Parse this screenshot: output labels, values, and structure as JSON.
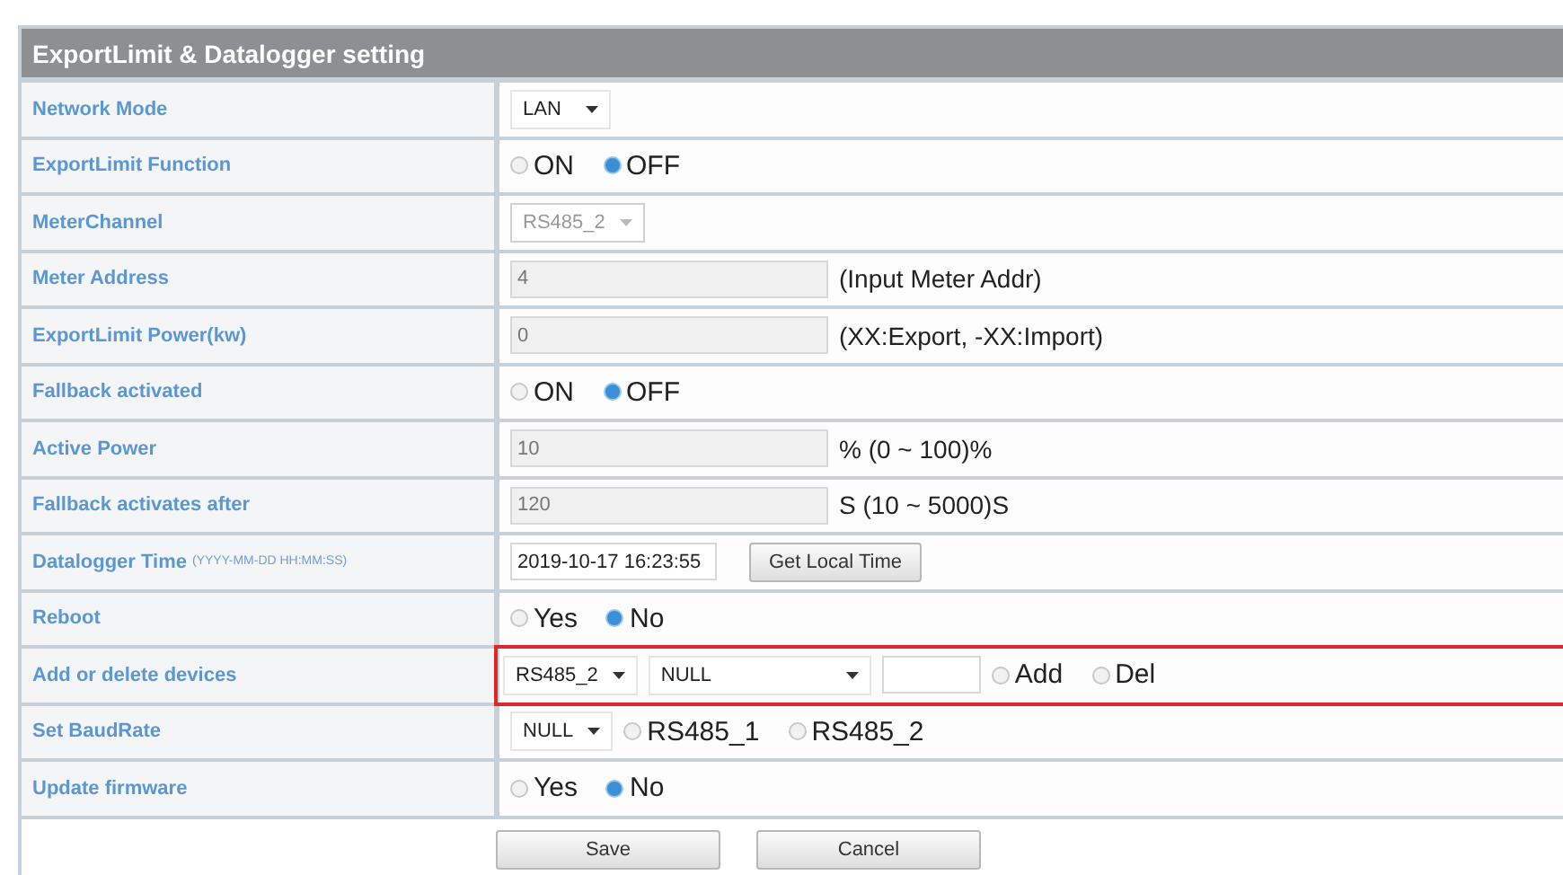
{
  "panel": {
    "title": "ExportLimit & Datalogger setting"
  },
  "rows": [
    {
      "label": "Network Mode",
      "highlighted": false,
      "controls": [
        {
          "kind": "select",
          "value": "LAN",
          "disabled": false
        }
      ]
    },
    {
      "label": "ExportLimit Function",
      "highlighted": false,
      "controls": [
        {
          "kind": "radio",
          "label": "ON",
          "selected": false
        },
        {
          "kind": "radio",
          "label": "OFF",
          "selected": true
        }
      ]
    },
    {
      "label": "MeterChannel",
      "highlighted": false,
      "controls": [
        {
          "kind": "select",
          "value": "RS485_2",
          "disabled": true
        }
      ]
    },
    {
      "label": "Meter Address",
      "highlighted": false,
      "controls": [
        {
          "kind": "input",
          "value": "4",
          "disabled": true
        },
        {
          "kind": "note",
          "text": "(Input Meter Addr)"
        }
      ]
    },
    {
      "label": "ExportLimit Power(kw)",
      "highlighted": false,
      "controls": [
        {
          "kind": "input",
          "value": "0",
          "disabled": true
        },
        {
          "kind": "note",
          "text": "(XX:Export, -XX:Import)"
        }
      ]
    },
    {
      "label": "Fallback activated",
      "highlighted": false,
      "controls": [
        {
          "kind": "radio",
          "label": "ON",
          "selected": false
        },
        {
          "kind": "radio",
          "label": "OFF",
          "selected": true
        }
      ]
    },
    {
      "label": "Active Power",
      "highlighted": false,
      "controls": [
        {
          "kind": "input",
          "value": "10",
          "disabled": true
        },
        {
          "kind": "note",
          "text": "% (0 ~ 100)%"
        }
      ]
    },
    {
      "label": "Fallback activates after",
      "highlighted": false,
      "controls": [
        {
          "kind": "input",
          "value": "120",
          "disabled": true
        },
        {
          "kind": "note",
          "text": "S (10 ~ 5000)S"
        }
      ]
    },
    {
      "label": "Datalogger Time",
      "hint": "(YYYY-MM-DD HH:MM:SS)",
      "highlighted": false,
      "controls": [
        {
          "kind": "input",
          "value": "2019-10-17 16:23:55",
          "disabled": false
        },
        {
          "kind": "button",
          "label": "Get Local Time"
        }
      ]
    },
    {
      "label": "Reboot",
      "highlighted": false,
      "controls": [
        {
          "kind": "radio",
          "label": "Yes",
          "selected": false
        },
        {
          "kind": "radio",
          "label": "No",
          "selected": true
        }
      ]
    },
    {
      "label": "Add or delete devices",
      "highlighted": true,
      "controls": [
        {
          "kind": "select",
          "value": "RS485_2",
          "disabled": false
        },
        {
          "kind": "select",
          "value": "NULL",
          "disabled": false
        },
        {
          "kind": "input",
          "disabled": false
        },
        {
          "kind": "radio",
          "label": "Add",
          "selected": false
        },
        {
          "kind": "radio",
          "label": "Del",
          "selected": false
        }
      ]
    },
    {
      "label": "Set BaudRate",
      "highlighted": false,
      "controls": [
        {
          "kind": "select",
          "value": "NULL",
          "disabled": false
        },
        {
          "kind": "radio",
          "label": "RS485_1",
          "selected": false
        },
        {
          "kind": "radio",
          "label": "RS485_2",
          "selected": false
        }
      ]
    },
    {
      "label": "Update firmware",
      "highlighted": false,
      "controls": [
        {
          "kind": "radio",
          "label": "Yes",
          "selected": false
        },
        {
          "kind": "radio",
          "label": "No",
          "selected": true
        }
      ]
    }
  ],
  "actions": [
    {
      "label": "Save"
    },
    {
      "label": "Cancel"
    }
  ]
}
